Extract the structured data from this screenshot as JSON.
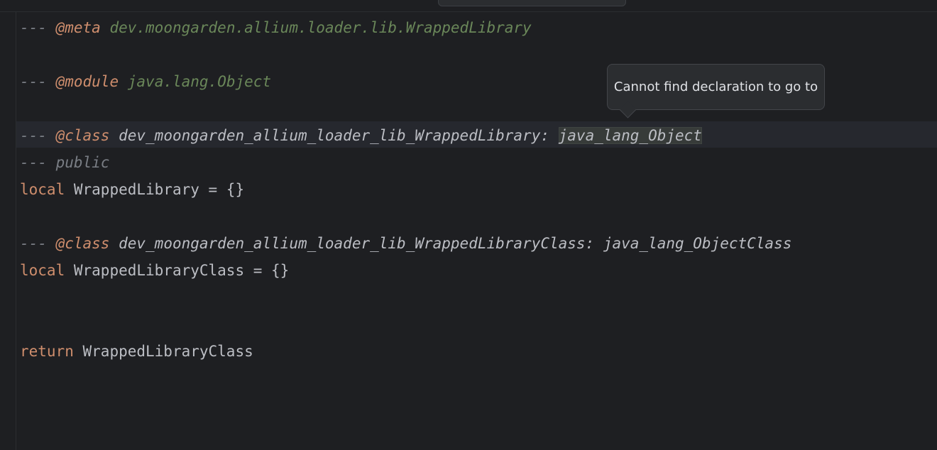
{
  "editor": {
    "lines": {
      "l1": {
        "dash": "---",
        "tag": "@meta",
        "value": "dev.moongarden.allium.loader.lib.WrappedLibrary"
      },
      "l2": {
        "dash": "---",
        "tag": "@module",
        "value": "java.lang.Object"
      },
      "l3": {
        "dash": "---",
        "tag": "@class",
        "name": "dev_moongarden_allium_loader_lib_WrappedLibrary:",
        "parent": "java_lang_Object"
      },
      "l4": {
        "dash": "---",
        "word": "public"
      },
      "l5": {
        "keyword": "local",
        "rest": "WrappedLibrary = {}"
      },
      "l6": {
        "dash": "---",
        "tag": "@class",
        "name": "dev_moongarden_allium_loader_lib_WrappedLibraryClass:",
        "parent": "java_lang_ObjectClass"
      },
      "l7": {
        "keyword": "local",
        "rest": "WrappedLibraryClass = {}"
      },
      "l8": {
        "keyword": "return",
        "rest": "WrappedLibraryClass"
      }
    }
  },
  "tooltip": {
    "text": "Cannot find declaration to go to"
  },
  "colors": {
    "background": "#1e1f22",
    "keyword": "#cf8e6d",
    "doc_type": "#6a8759",
    "comment": "#7a7e85"
  }
}
